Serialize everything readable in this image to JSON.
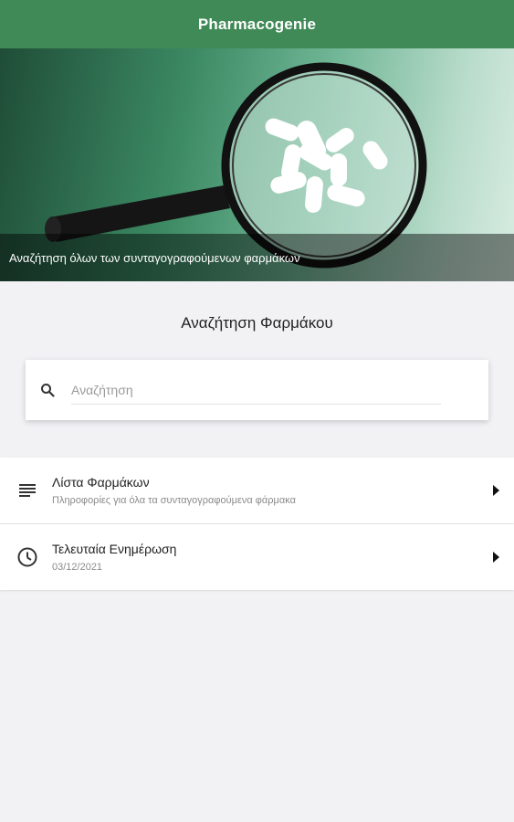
{
  "app_bar": {
    "title": "Pharmacogenie"
  },
  "hero": {
    "caption": "Αναζήτηση όλων των συνταγογραφούμενων φαρμάκων"
  },
  "search_section": {
    "title": "Αναζήτηση Φαρμάκου",
    "placeholder": "Αναζήτηση",
    "value": ""
  },
  "list": {
    "items": [
      {
        "icon": "list-lines-icon",
        "title": "Λίστα Φαρμάκων",
        "subtitle": "Πληροφορίες για όλα τα συνταγογραφούμενα φάρμακα"
      },
      {
        "icon": "clock-icon",
        "title": "Τελευταία Ενημέρωση",
        "subtitle": "03/12/2021"
      }
    ]
  },
  "colors": {
    "app_bar": "#3f8a57",
    "background": "#f2f2f5"
  }
}
